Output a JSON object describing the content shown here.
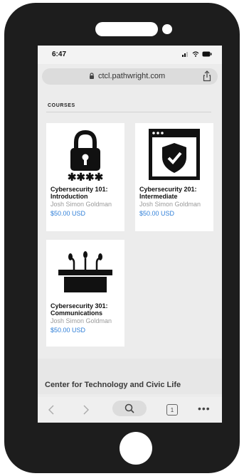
{
  "status_bar": {
    "time": "6:47"
  },
  "browser": {
    "url": "ctcl.pathwright.com"
  },
  "section": {
    "label": "COURSES"
  },
  "courses": [
    {
      "title": "Cybersecurity 101: Introduction",
      "author": "Josh Simon Goldman",
      "price": "$50.00 USD",
      "icon": "padlock-icon"
    },
    {
      "title": "Cybersecurity 201: Intermediate",
      "author": "Josh Simon Goldman",
      "price": "$50.00 USD",
      "icon": "browser-shield-icon"
    },
    {
      "title": "Cybersecurity 301: Communications",
      "author": "Josh Simon Goldman",
      "price": "$50.00 USD",
      "icon": "podium-microphones-icon"
    }
  ],
  "footer": {
    "org_name": "Center for Technology and Civic Life"
  },
  "toolbar": {
    "tab_count": "1",
    "more": "•••"
  },
  "colors": {
    "phone_body": "#1d1d1d",
    "price_link": "#2f7fd8",
    "screen_bg": "#ececec"
  }
}
